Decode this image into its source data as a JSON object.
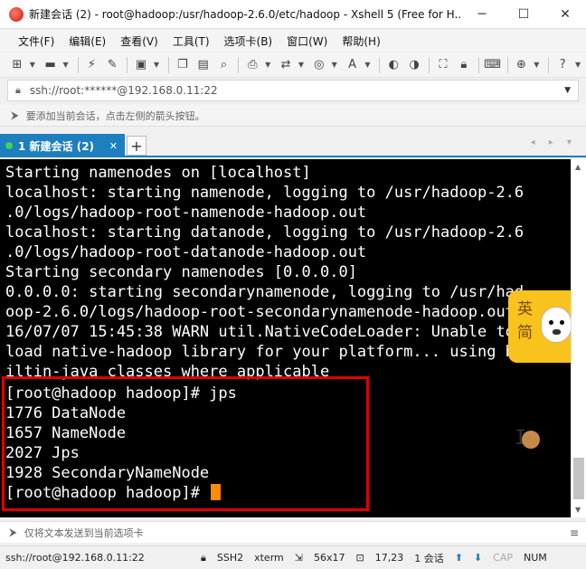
{
  "window": {
    "title": "新建会话 (2) - root@hadoop:/usr/hadoop-2.6.0/etc/hadoop - Xshell 5 (Free for H...",
    "minimize": "─",
    "maximize": "☐",
    "close": "✕"
  },
  "menu": [
    "文件(F)",
    "编辑(E)",
    "查看(V)",
    "工具(T)",
    "选项卡(B)",
    "窗口(W)",
    "帮助(H)"
  ],
  "address": {
    "value": "ssh://root:******@192.168.0.11:22",
    "dropdown": "▼"
  },
  "hint": {
    "text": "要添加当前会话，点击左侧的箭头按钮。"
  },
  "tabs": {
    "active_label": "1 新建会话 (2)",
    "close": "✕",
    "add": "+",
    "nav": "◂ ▸ ▾"
  },
  "terminal": {
    "lines": [
      "Starting namenodes on [localhost]",
      "localhost: starting namenode, logging to /usr/hadoop-2.6",
      ".0/logs/hadoop-root-namenode-hadoop.out",
      "localhost: starting datanode, logging to /usr/hadoop-2.6",
      ".0/logs/hadoop-root-datanode-hadoop.out",
      "Starting secondary namenodes [0.0.0.0]",
      "0.0.0.0: starting secondarynamenode, logging to /usr/had",
      "oop-2.6.0/logs/hadoop-root-secondarynamenode-hadoop.out",
      "16/07/07 15:45:38 WARN util.NativeCodeLoader: Unable to",
      "load native-hadoop library for your platform... using b",
      "iltin-java classes where applicable",
      "[root@hadoop hadoop]# jps",
      "1776 DataNode",
      "1657 NameNode",
      "2027 Jps",
      "1928 SecondaryNameNode",
      "[root@hadoop hadoop]# "
    ],
    "ime_char1": "英",
    "ime_char2": "简"
  },
  "sendbar": {
    "text": "仅将文本发送到当前选项卡",
    "menu": "≡"
  },
  "status": {
    "connection": "ssh://root@192.168.0.11:22",
    "protocol": "SSH2",
    "term": "xterm",
    "size": "56x17",
    "position": "17,23",
    "sessions": "1 会话",
    "caps": "CAP",
    "num": "NUM"
  },
  "colors": {
    "tab_accent": "#1d7fbd",
    "highlight_box": "#e00000",
    "cursor": "#ff8c00",
    "terminal_bg": "#000000",
    "terminal_fg": "#ffffff"
  }
}
